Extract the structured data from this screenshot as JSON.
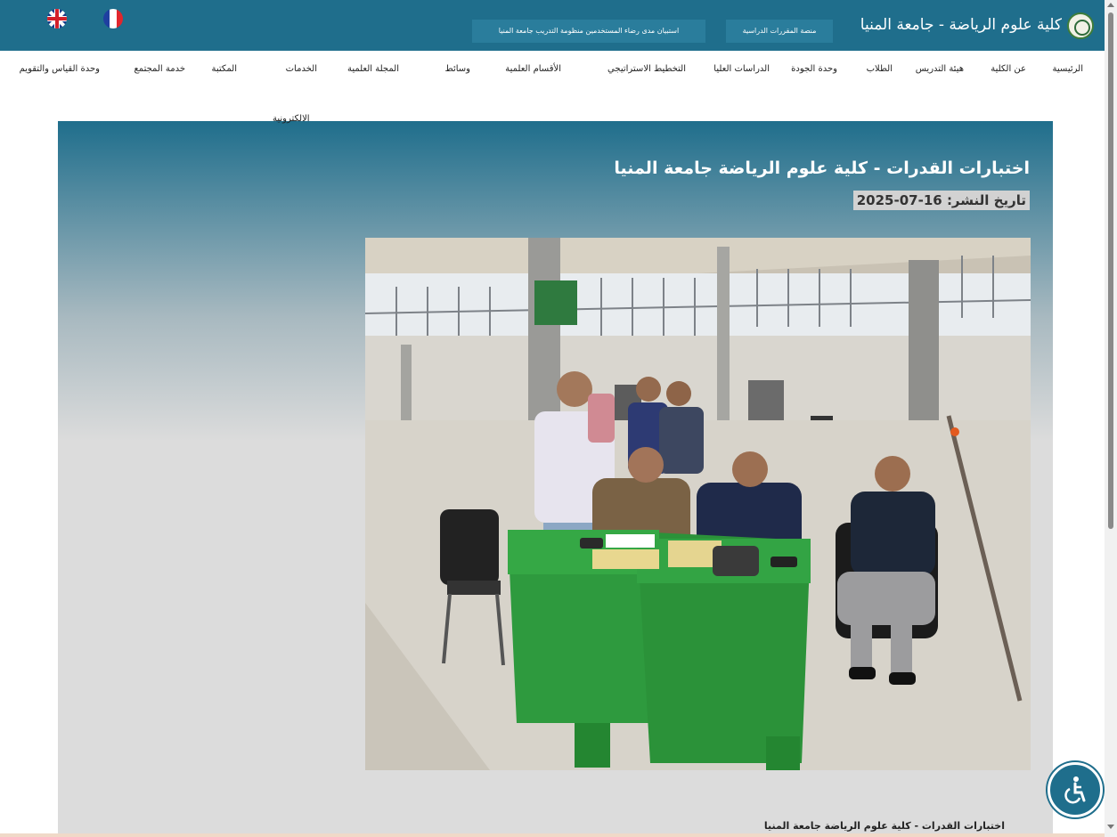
{
  "header": {
    "site_title": "كلية علوم الرياضة - جامعة المنيا",
    "survey_button": "استبيان مدى رضاء المستخدمين منظومة التدريب جامعة المنيا",
    "courses_button": "منصة المقررات الدراسية",
    "languages": [
      {
        "icon": "uk-flag-icon"
      },
      {
        "icon": "france-flag-icon"
      }
    ],
    "colors": {
      "bar": "#1f6e8c",
      "button": "#2a7d9c"
    }
  },
  "nav": {
    "items": [
      {
        "label": "الرئيسية"
      },
      {
        "label": "عن الكلية"
      },
      {
        "label": "هيئة التدريس"
      },
      {
        "label": "الطلاب"
      },
      {
        "label": "وحدة الجودة"
      },
      {
        "label": "الدراسات العليا"
      },
      {
        "label": "التخطيط الاستراتيجي"
      },
      {
        "label": "الأقسام العلمية"
      },
      {
        "label": "وسائط"
      },
      {
        "label": "المجلة العلمية"
      },
      {
        "label": "الخدمات"
      },
      {
        "label": "المكتبة"
      },
      {
        "label": "خدمة المجتمع"
      },
      {
        "label": "وحدة القياس والتقويم"
      }
    ],
    "services_wrap": "الالكترونية"
  },
  "article": {
    "title": "اختبارات القدرات - كلية علوم الرياضة جامعة المنيا",
    "date_label": "تاريخ النشر:",
    "date_value": "16-07-2025",
    "caption": "اختبارات القدرات - كلية علوم الرياضة جامعة المنيا",
    "photo_icon": "photo-ability-tests"
  },
  "accessibility": {
    "icon": "accessibility-icon"
  }
}
